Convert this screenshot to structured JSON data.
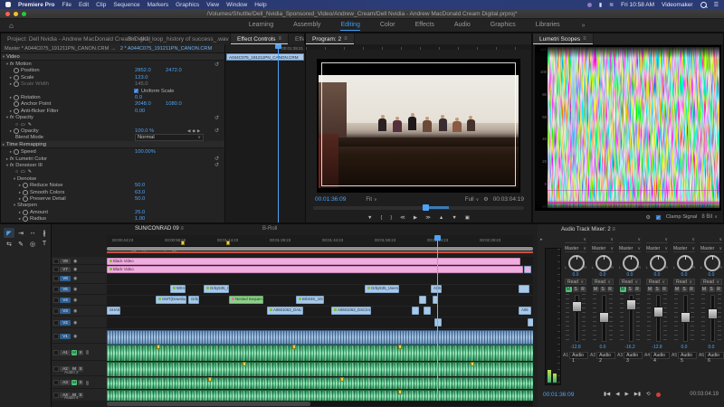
{
  "menu_bar": {
    "app": "Premiere Pro",
    "items": [
      "File",
      "Edit",
      "Clip",
      "Sequence",
      "Markers",
      "Graphics",
      "View",
      "Window",
      "Help"
    ],
    "time": "Fri 10:58 AM",
    "user": "Videomaker"
  },
  "title_bar": {
    "path": "/Volumes/Shuttle/Dell_Nvidia_Sponsored_Video/Andrew_Cream/Dell Nvidia - Andrew MacDonald Cream Digital.prproj*"
  },
  "workspaces": {
    "items": [
      "Learning",
      "Assembly",
      "Editing",
      "Color",
      "Effects",
      "Audio",
      "Graphics",
      "Libraries"
    ],
    "overflow": "»"
  },
  "effect_controls": {
    "tab_project": "Project: Dell Nvidia - Andrew MacDonald Cream Digital",
    "tab_bin": "Bin: 4k2_loop_history of success_.wav",
    "tab_effect_controls": "Effect Controls",
    "tab_effects": "Effects",
    "master_clip": "Master * A044C075_191211PN_CANON.CRM",
    "arrow": "→",
    "track_clip": "2 * A044C075_191211PN_CANON.CRM",
    "mini_timecode": "00:01:39:21",
    "clip_bar": "A044C075_191211PN_CANON.CRM",
    "video_label": "Video",
    "fx_badge": "fx",
    "motion": "Motion",
    "position": "Position",
    "position_x": "2852.0",
    "position_y": "2472.0",
    "scale": "Scale",
    "scale_v": "123.0",
    "scale_width": "Scale Width",
    "scale_width_v": "145.0",
    "uniform_scale": "Uniform Scale",
    "rotation": "Rotation",
    "rotation_v": "0.0",
    "anchor": "Anchor Point",
    "anchor_x": "2048.0",
    "anchor_y": "1080.0",
    "antiflicker": "Anti-flicker Filter",
    "antiflicker_v": "0.00",
    "opacity_fx": "Opacity",
    "opacity": "Opacity",
    "opacity_v": "100.0 %",
    "blend_mode": "Blend Mode",
    "blend_mode_v": "Normal",
    "time_remapping": "Time Remapping",
    "speed": "Speed",
    "speed_v": "100.00%",
    "lumetri_color": "Lumetri Color",
    "denoiser": "Denoiser III",
    "denoise_group": "Denoise",
    "reduce_noise": "Reduce Noise",
    "reduce_noise_v": "50.0",
    "smooth_colors": "Smooth Colors",
    "smooth_colors_v": "63.0",
    "preserve_detail": "Preserve Detail",
    "preserve_detail_v": "50.0",
    "sharpen_group": "Sharpen",
    "amount": "Amount",
    "amount_v": "25.0",
    "radius": "Radius",
    "radius_v": "1.00"
  },
  "program": {
    "tab": "Program: 2",
    "timecode": "00:01:36:09",
    "fit": "Fit",
    "quality": "Full",
    "duration": "00:03:04:19"
  },
  "lumetri": {
    "tab": "Lumetri Scopes",
    "clamp": "Clamp Signal",
    "bits": "8 Bit",
    "scale": [
      "120",
      "100",
      "80",
      "60",
      "40",
      "20",
      "0",
      "-20"
    ]
  },
  "timeline": {
    "tab1": "SUN/CONRAD 09",
    "tab2": "B-Roll",
    "timecode": "00:01:36:09",
    "ruler": [
      "00:00:44:23",
      "00:00:59:23",
      "00:01:14:23",
      "00:01:29:23",
      "00:01:44:23",
      "00:01:59:23",
      "00:02:14:23",
      "00:02:29:23"
    ],
    "video_tracks": [
      "V8",
      "V7",
      "V6",
      "V5",
      "V4",
      "V3",
      "V2",
      "V1"
    ],
    "audio_tracks": [
      "A1",
      "A2",
      "A3",
      "A4"
    ],
    "audio_names": {
      "a2": "Audio 2",
      "a4": "Audio 4"
    },
    "mute": "M",
    "solo": "S",
    "clips": [
      {
        "label": "Black Video"
      },
      {
        "label": "Black Video"
      },
      {
        "label": "W0431Dy"
      },
      {
        "label": "Grby535_User"
      },
      {
        "label": "Grby535_Usersgraph"
      },
      {
        "label": "GMT(Download)0126.MP4"
      },
      {
        "label": "Grby"
      },
      {
        "label": "Nested Sequence 08"
      },
      {
        "label": "Brb04K_1043_1065_"
      },
      {
        "label": "A0601063_DAILY"
      },
      {
        "label": "A0601063_DSC04878_1"
      },
      {
        "label": "SHA04K"
      },
      {
        "label": "A0601"
      },
      {
        "label": "A06"
      }
    ]
  },
  "mixer": {
    "title": "Audio Track Mixer: 2",
    "assign": "Master",
    "pan": "0.0",
    "auto": "Read",
    "btn_m": "M",
    "btn_s": "S",
    "btn_r": "R",
    "channels": [
      {
        "num": "A1",
        "name": "Audio 1",
        "db": "-12.8"
      },
      {
        "num": "A2",
        "name": "Audio 2",
        "db": "0.0"
      },
      {
        "num": "A3",
        "name": "Audio 3",
        "db": "-16.2"
      },
      {
        "num": "A4",
        "name": "Audio 4",
        "db": "-12.8"
      },
      {
        "num": "A5",
        "name": "Audio 5",
        "db": "0.0"
      },
      {
        "num": "A6",
        "name": "Audio 6",
        "db": "0.0"
      }
    ],
    "timecode": "00:01:36:09",
    "duration": "00:03:04:19"
  }
}
